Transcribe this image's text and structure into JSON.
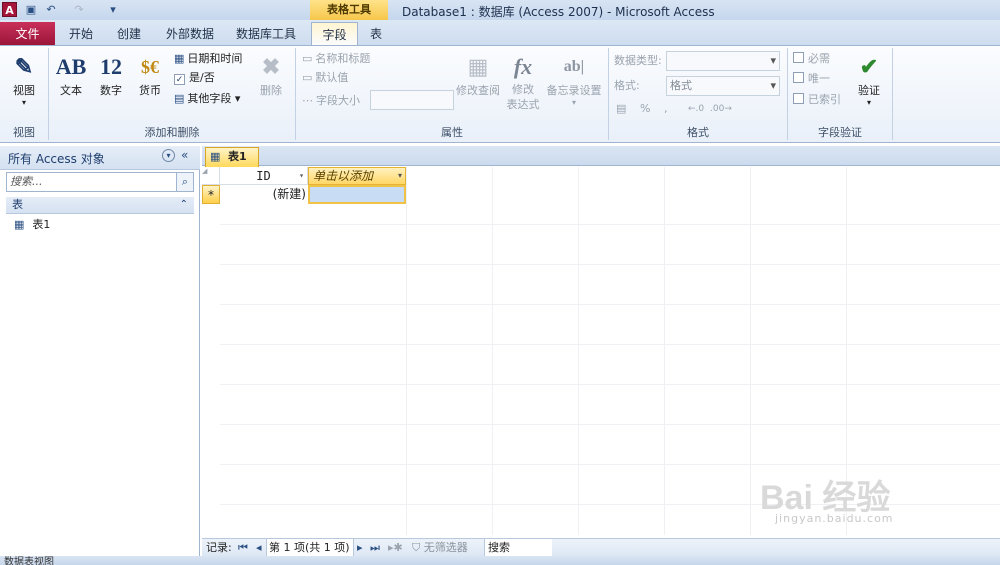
{
  "titlebar": {
    "app_icon": "A",
    "context_group": "表格工具",
    "title": "Database1 : 数据库 (Access 2007)  -  Microsoft Access"
  },
  "tabs": {
    "file": "文件",
    "items": [
      "开始",
      "创建",
      "外部数据",
      "数据库工具",
      "字段",
      "表"
    ]
  },
  "ribbon": {
    "view": {
      "label": "视图",
      "group": "视图"
    },
    "add_delete": {
      "group": "添加和删除",
      "text": "文本",
      "text_icon": "AB",
      "number": "数字",
      "number_icon": "12",
      "currency": "货币",
      "datetime": "日期和时间",
      "yesno": "是/否",
      "more": "其他字段",
      "delete": "删除"
    },
    "properties": {
      "group": "属性",
      "name_caption": "名称和标题",
      "default_value": "默认值",
      "field_size": "字段大小",
      "modify_lookups": "修改查阅",
      "modify_expr": "修改\n表达式",
      "memo_settings": "备忘录设置"
    },
    "format": {
      "group": "格式",
      "data_type_label": "数据类型:",
      "format_label": "格式:",
      "format_value": "格式",
      "pct": "%",
      "comma": ","
    },
    "validation": {
      "group": "字段验证",
      "required": "必需",
      "unique": "唯一",
      "indexed": "已索引",
      "validate": "验证"
    }
  },
  "nav": {
    "header": "所有 Access 对象",
    "search_placeholder": "搜索...",
    "group": "表",
    "items": [
      "表1"
    ]
  },
  "doc": {
    "tab": "表1",
    "columns": [
      "ID",
      "单击以添加"
    ],
    "new_row_marker": "*",
    "new_row_value": "(新建)"
  },
  "recnav": {
    "label": "记录:",
    "position": "第 1 项(共 1 项)",
    "filter": "无筛选器",
    "search": "搜索"
  },
  "status": "数据表视图",
  "watermark": {
    "text": "Bai 经验",
    "url": "jingyan.baidu.com"
  }
}
